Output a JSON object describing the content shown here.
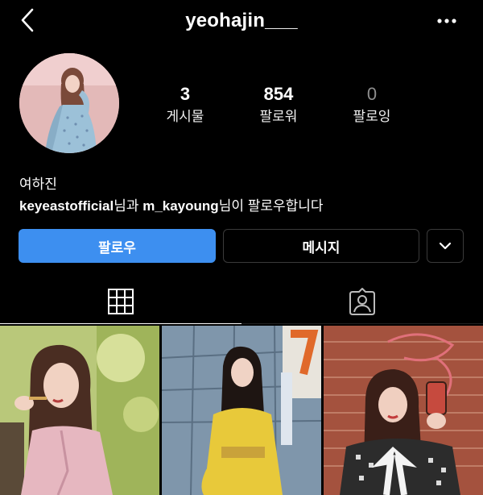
{
  "header": {
    "username": "yeohajin___",
    "back_icon": "chevron-left-icon",
    "more_icon": "more-horizontal-icon"
  },
  "profile": {
    "stats": {
      "posts": {
        "count": "3",
        "label": "게시물"
      },
      "followers": {
        "count": "854",
        "label": "팔로워"
      },
      "following": {
        "count": "0",
        "label": "팔로잉"
      }
    },
    "full_name": "여하진",
    "followed_by": {
      "user1": "keyeastofficial",
      "connector": "님과 ",
      "user2": "m_kayoung",
      "suffix": "님이 팔로우합니다"
    }
  },
  "actions": {
    "follow_label": "팔로우",
    "message_label": "메시지",
    "more_icon": "chevron-down-icon"
  },
  "tabs": {
    "grid_icon": "grid-icon",
    "tagged_icon": "tagged-person-icon",
    "active": "grid"
  },
  "colors": {
    "background": "#000000",
    "follow_button": "#3d8ff0",
    "muted_text": "#8e8e8e"
  },
  "posts": [
    {
      "alt": "woman in pink coat outdoors"
    },
    {
      "alt": "woman in yellow coat in front of glass building"
    },
    {
      "alt": "woman taking mirror selfie by brick wall"
    }
  ]
}
